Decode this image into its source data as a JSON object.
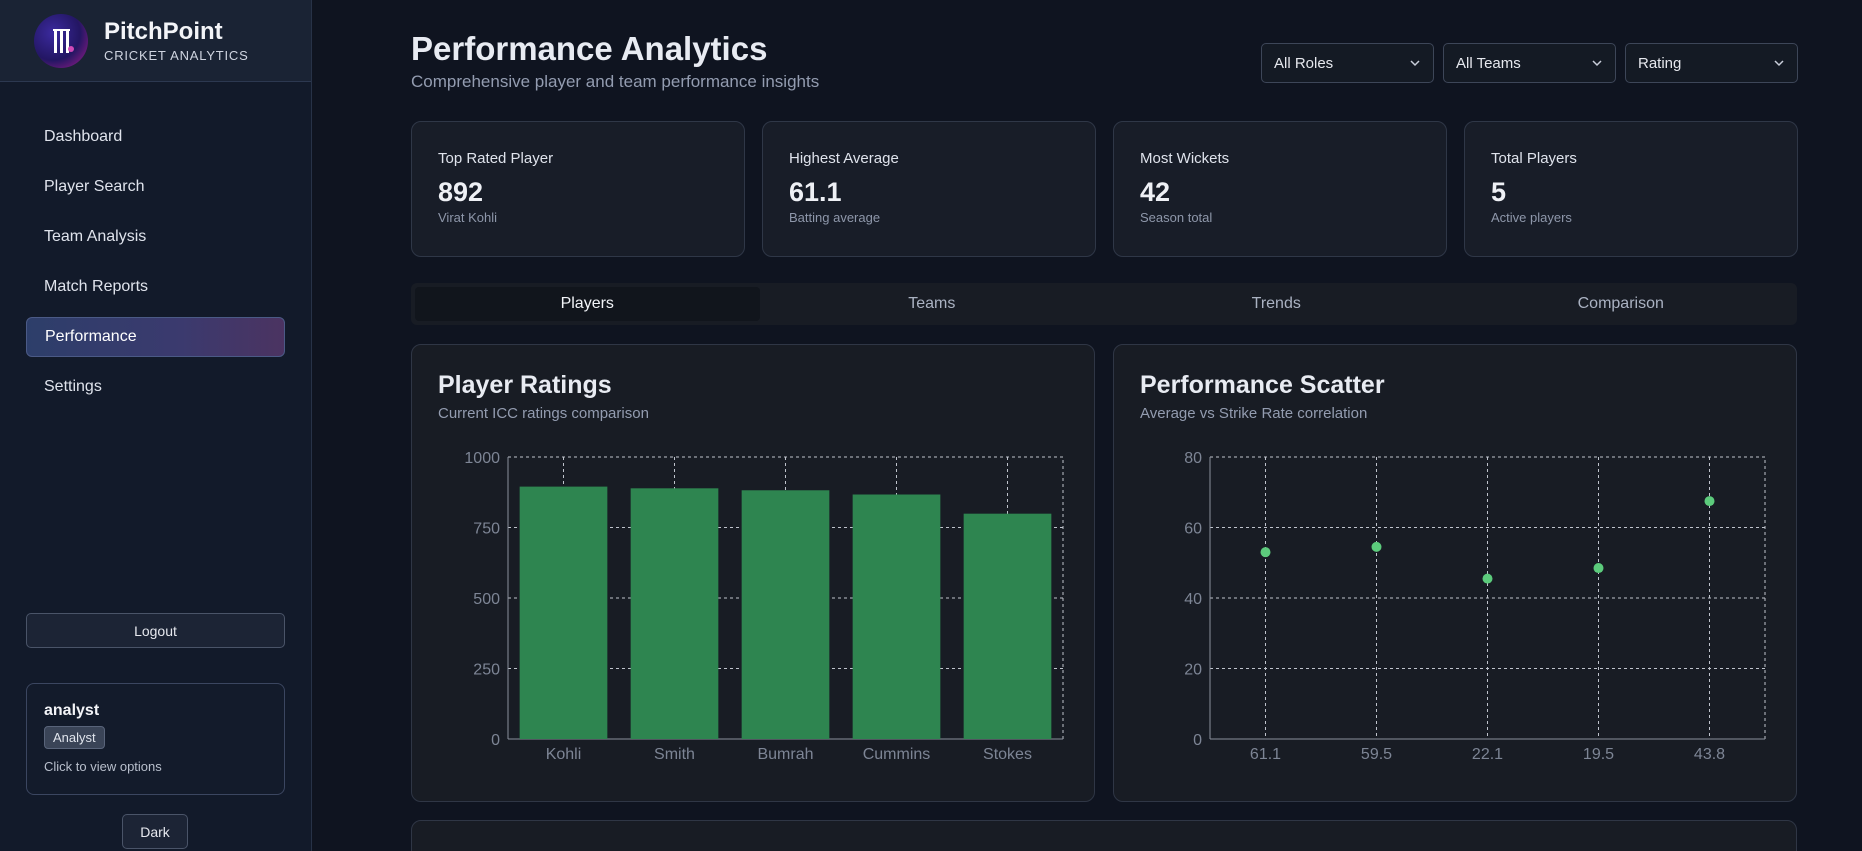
{
  "brand": {
    "name": "PitchPoint",
    "subtitle": "CRICKET ANALYTICS"
  },
  "sidebar": {
    "items": [
      {
        "label": "Dashboard"
      },
      {
        "label": "Player Search"
      },
      {
        "label": "Team Analysis"
      },
      {
        "label": "Match Reports"
      },
      {
        "label": "Performance",
        "active": true
      },
      {
        "label": "Settings"
      }
    ],
    "logout_label": "Logout",
    "user": {
      "name": "analyst",
      "role": "Analyst",
      "hint": "Click to view options"
    },
    "theme_label": "Dark"
  },
  "header": {
    "title": "Performance Analytics",
    "subtitle": "Comprehensive player and team performance insights"
  },
  "filters": [
    {
      "value": "All Roles"
    },
    {
      "value": "All Teams"
    },
    {
      "value": "Rating"
    }
  ],
  "stats": [
    {
      "label": "Top Rated Player",
      "value": "892",
      "note": "Virat Kohli"
    },
    {
      "label": "Highest Average",
      "value": "61.1",
      "note": "Batting average"
    },
    {
      "label": "Most Wickets",
      "value": "42",
      "note": "Season total"
    },
    {
      "label": "Total Players",
      "value": "5",
      "note": "Active players"
    }
  ],
  "tabs": [
    {
      "label": "Players",
      "active": true
    },
    {
      "label": "Teams"
    },
    {
      "label": "Trends"
    },
    {
      "label": "Comparison"
    }
  ],
  "panels": {
    "ratings": {
      "title": "Player Ratings",
      "subtitle": "Current ICC ratings comparison"
    },
    "scatter": {
      "title": "Performance Scatter",
      "subtitle": "Average vs Strike Rate correlation"
    }
  },
  "colors": {
    "accent": "#2e8550",
    "point": "#5ccb7c",
    "grid": "#bfc3cc"
  },
  "chart_data": [
    {
      "type": "bar",
      "categories": [
        "Kohli",
        "Smith",
        "Bumrah",
        "Cummins",
        "Stokes"
      ],
      "values": [
        895,
        889,
        882,
        867,
        799
      ],
      "ylim": [
        0,
        1000
      ],
      "yticks": [
        0,
        250,
        500,
        750,
        1000
      ],
      "grid": true
    },
    {
      "type": "scatter",
      "x": [
        "61.1",
        "59.5",
        "22.1",
        "19.5",
        "43.8"
      ],
      "y": [
        53,
        54.5,
        45.5,
        48.5,
        67.5
      ],
      "ylim": [
        0,
        80
      ],
      "yticks": [
        0,
        20,
        40,
        60,
        80
      ],
      "grid": true
    }
  ]
}
